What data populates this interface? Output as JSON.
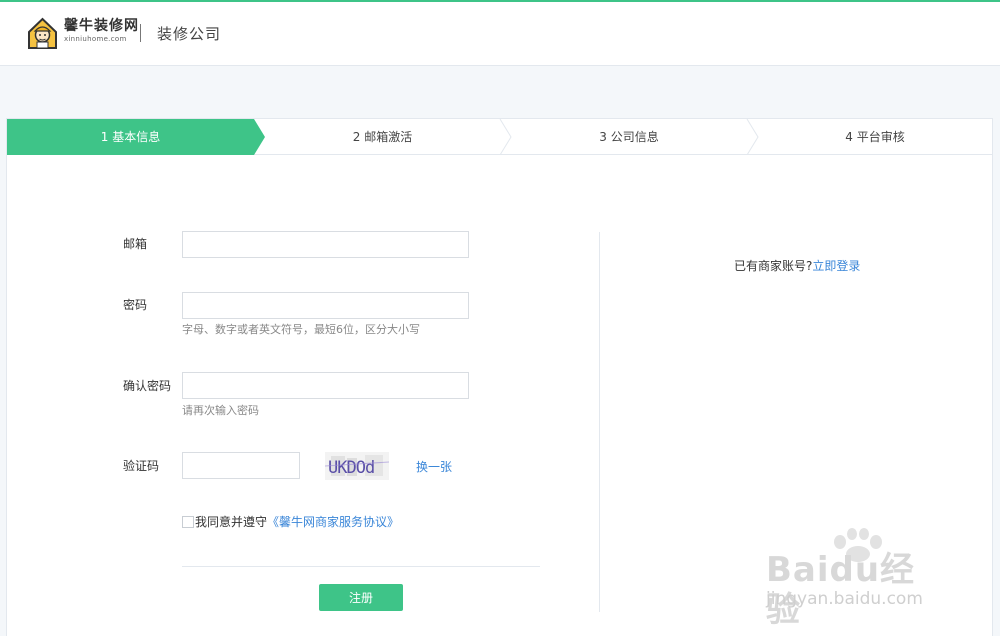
{
  "header": {
    "brand_name": "馨牛装修网",
    "brand_domain": "xinniuhome.com",
    "section_title": "装修公司"
  },
  "steps": [
    {
      "label": "1 基本信息",
      "active": true
    },
    {
      "label": "2 邮箱激活",
      "active": false
    },
    {
      "label": "3 公司信息",
      "active": false
    },
    {
      "label": "4 平台审核",
      "active": false
    }
  ],
  "form": {
    "email_label": "邮箱",
    "email_value": "",
    "password_label": "密码",
    "password_value": "",
    "password_hint": "字母、数字或者英文符号，最短6位，区分大小写",
    "confirm_label": "确认密码",
    "confirm_value": "",
    "confirm_hint": "请再次输入密码",
    "captcha_label": "验证码",
    "captcha_value": "",
    "captcha_image_text": "UKDOd",
    "refresh_label": "换一张",
    "agree_text": "我同意并遵守",
    "agree_link": "《馨牛网商家服务协议》",
    "agree_checked": false,
    "submit_label": "注册"
  },
  "side": {
    "login_prompt": "已有商家账号?",
    "login_link": "立即登录"
  },
  "watermark": {
    "main": "Baidu经验",
    "sub": "jingyan.baidu.com"
  },
  "colors": {
    "accent": "#3ec488",
    "link": "#3a86d8",
    "page_bg": "#f4f7fa"
  },
  "icons": {
    "logo": "cartoon-worker-logo-icon",
    "captcha": "captcha-image"
  }
}
